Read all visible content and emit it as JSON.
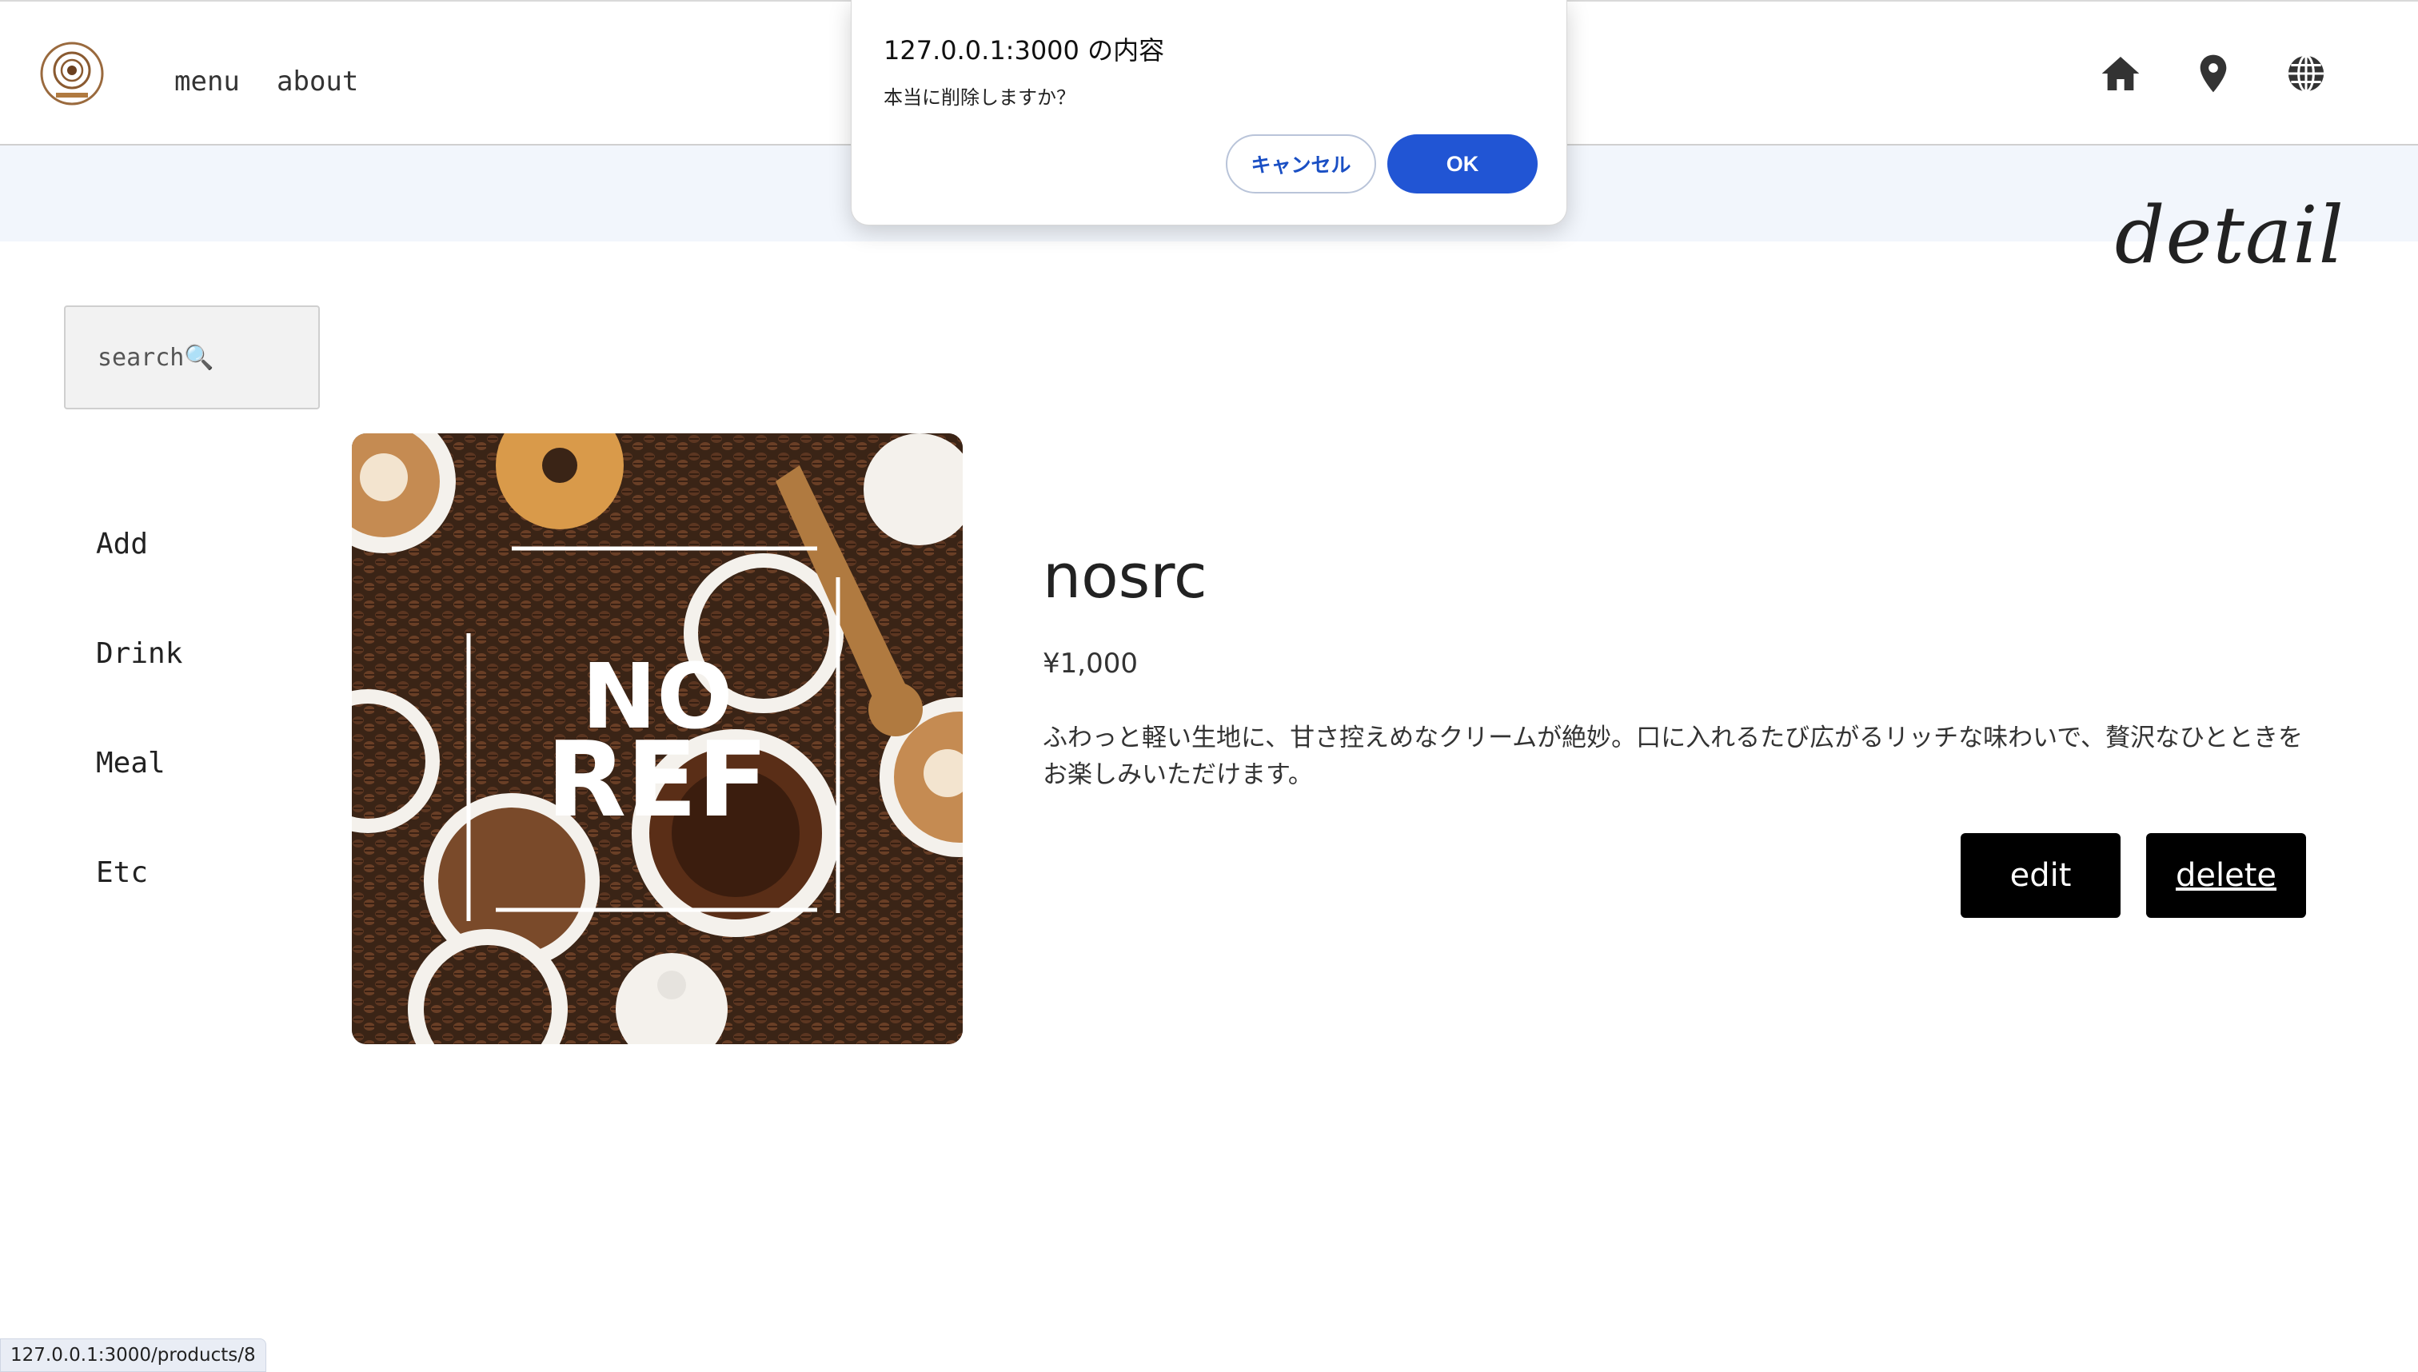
{
  "header": {
    "nav": {
      "menu": "menu",
      "about": "about"
    },
    "icons": [
      "home-icon",
      "location-pin-icon",
      "globe-icon"
    ]
  },
  "banner": {
    "title": "detail"
  },
  "sidebar": {
    "search_placeholder": "search🔍",
    "items": [
      {
        "label": "Add"
      },
      {
        "label": "Drink"
      },
      {
        "label": "Meal"
      },
      {
        "label": "Etc"
      }
    ]
  },
  "product": {
    "image_text": [
      "NO",
      "REF"
    ],
    "name": "nosrc",
    "price": "¥1,000",
    "description": "ふわっと軽い生地に、甘さ控えめなクリームが絶妙。口に入れるたび広がるリッチな味わいで、贅沢なひとときをお楽しみいただけます。",
    "edit_label": "edit",
    "delete_label": "delete"
  },
  "dialog": {
    "title": "127.0.0.1:3000 の内容",
    "message": "本当に削除しますか？",
    "cancel_label": "キャンセル",
    "ok_label": "OK"
  },
  "status_bar": {
    "url": "127.0.0.1:3000/products/8"
  },
  "colors": {
    "banner_bg": "#f2f6fc",
    "button_bg": "#000000",
    "dialog_ok": "#2155d4"
  }
}
